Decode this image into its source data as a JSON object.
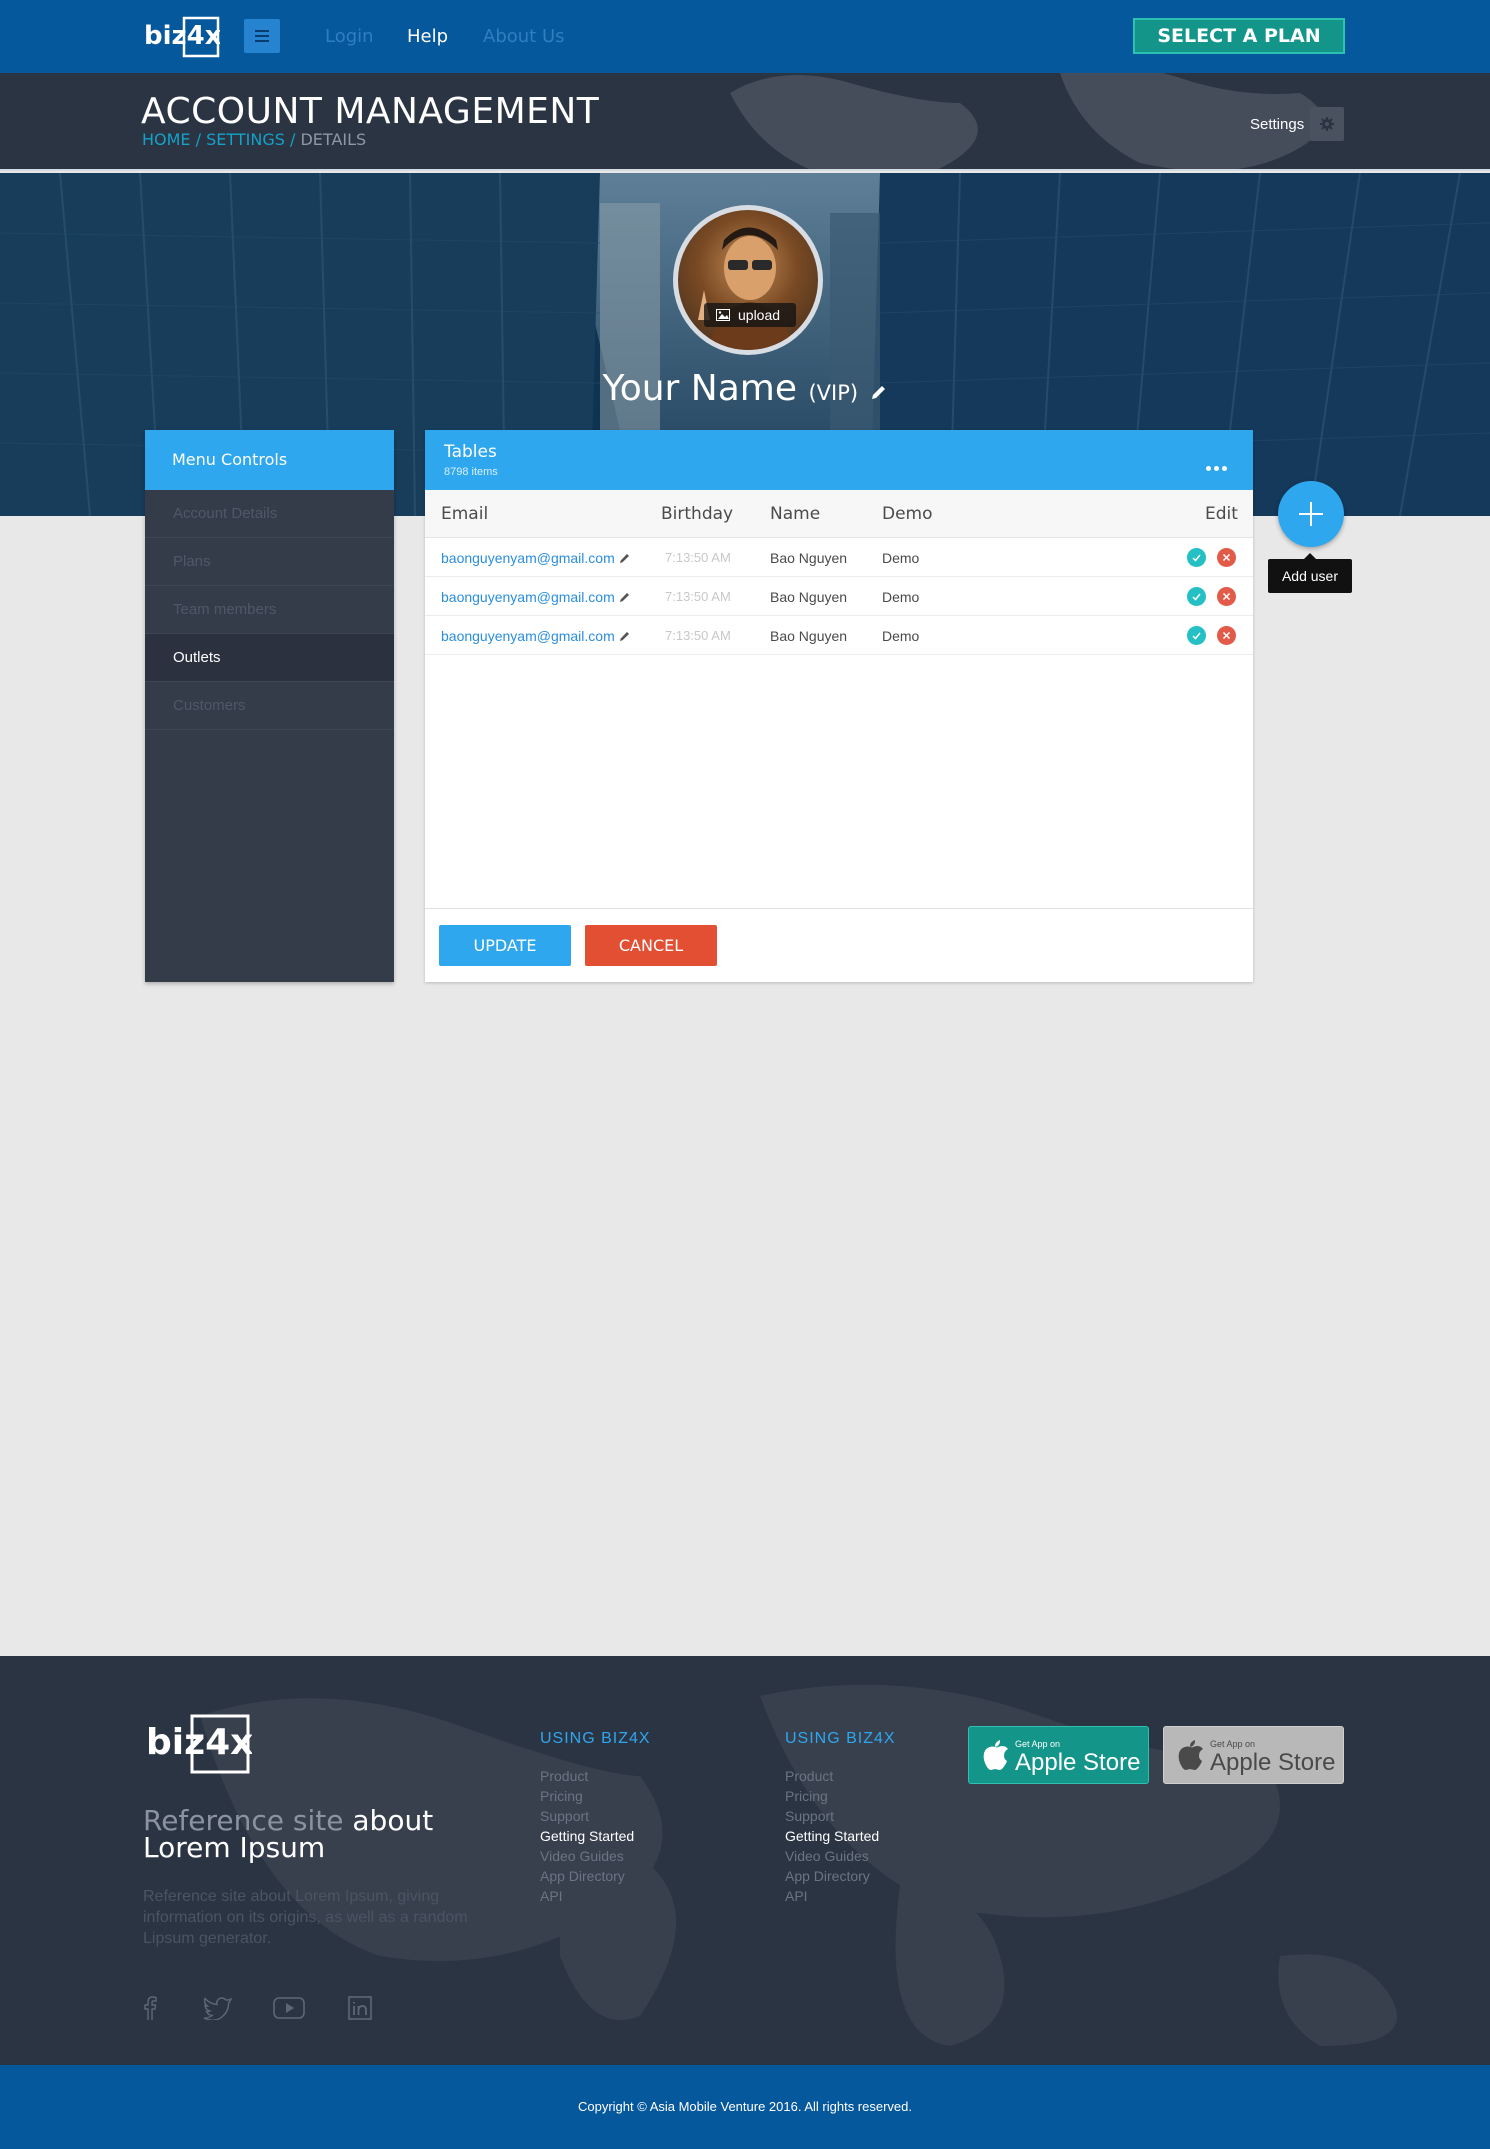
{
  "brand": {
    "logo_text": "biz4x"
  },
  "nav": {
    "links": [
      {
        "label": "Login",
        "state": "dim"
      },
      {
        "label": "Help",
        "state": "active"
      },
      {
        "label": "About Us",
        "state": "dim"
      }
    ],
    "cta_label": "SELECT A PLAN"
  },
  "account": {
    "title": "ACCOUNT MANAGEMENT",
    "breadcrumb": {
      "home": "HOME",
      "settings": "SETTINGS",
      "current": "DETAILS",
      "separator": "/"
    },
    "settings_label": "Settings"
  },
  "profile": {
    "upload_label": "upload",
    "name": "Your Name",
    "badge": "(VIP)"
  },
  "sidebar": {
    "title": "Menu Controls",
    "items": [
      {
        "label": "Account Details",
        "active": false
      },
      {
        "label": "Plans",
        "active": false
      },
      {
        "label": "Team members",
        "active": false
      },
      {
        "label": "Outlets",
        "active": true
      },
      {
        "label": "Customers",
        "active": false
      }
    ]
  },
  "table": {
    "title": "Tables",
    "count": "8798 items",
    "columns": [
      "Email",
      "Birthday",
      "Name",
      "Demo",
      "Edit"
    ],
    "rows": [
      {
        "email": "baonguyenyam@gmail.com",
        "birthday": "7:13:50 AM",
        "name": "Bao Nguyen",
        "demo": "Demo"
      },
      {
        "email": "baonguyenyam@gmail.com",
        "birthday": "7:13:50 AM",
        "name": "Bao Nguyen",
        "demo": "Demo"
      },
      {
        "email": "baonguyenyam@gmail.com",
        "birthday": "7:13:50 AM",
        "name": "Bao Nguyen",
        "demo": "Demo"
      }
    ],
    "update_label": "UPDATE",
    "cancel_label": "CANCEL"
  },
  "fab": {
    "tooltip": "Add user"
  },
  "footer": {
    "tagline_grey": "Reference site",
    "tagline_white": "about",
    "tagline_line2": "Lorem Ipsum",
    "description": "Reference site about Lorem Ipsum, giving information on its origins, as well as a random Lipsum generator.",
    "columns": [
      {
        "heading": "USING  BIZ4X",
        "links": [
          "Product",
          "Pricing",
          "Support",
          "Getting Started",
          "Video Guides",
          "App Directory",
          "API"
        ]
      },
      {
        "heading": "USING  BIZ4X",
        "links": [
          "Product",
          "Pricing",
          "Support",
          "Getting Started",
          "Video Guides",
          "App Directory",
          "API"
        ]
      }
    ],
    "stores": [
      {
        "small": "Get App on",
        "big": "Apple Store",
        "style": "teal"
      },
      {
        "small": "Get App on",
        "big": "Apple Store",
        "style": "grey"
      }
    ],
    "social": [
      "facebook-icon",
      "twitter-icon",
      "youtube-icon",
      "linkedin-icon"
    ],
    "copyright": "Copyright © Asia Mobile Venture 2016. All rights reserved."
  },
  "colors": {
    "nav_bg": "#06589c",
    "accent_blue": "#2ea7ee",
    "teal": "#14958a",
    "danger": "#e24f33",
    "dark_panel": "#2b3443"
  }
}
